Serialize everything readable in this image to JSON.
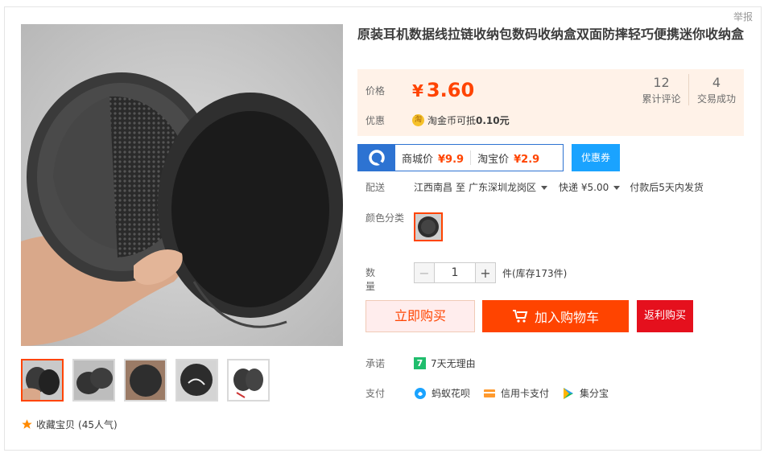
{
  "header": {
    "report_label": "举报"
  },
  "product": {
    "title": "原装耳机数据线拉链收纳包数码收纳盒双面防摔轻巧便携迷你收纳盒"
  },
  "price": {
    "label": "价格",
    "currency": "¥",
    "amount": "3.60",
    "reviews_count": "12",
    "reviews_label": "累计评论",
    "deals_count": "4",
    "deals_label": "交易成功"
  },
  "promo": {
    "label": "优惠",
    "icon_text": "淘",
    "text_prefix": "淘金币可抵",
    "text_amount": "0.10元"
  },
  "coupon": {
    "mall_label": "商城价",
    "mall_price": "¥9.9",
    "taobao_label": "淘宝价",
    "taobao_price": "¥2.9",
    "button_label": "优惠券"
  },
  "shipping": {
    "label": "配送",
    "from": "江西南昌",
    "to_word": "至",
    "destination": "广东深圳龙岗区",
    "express": "快递",
    "fee": "¥5.00",
    "dispatch": "付款后5天内发货"
  },
  "color": {
    "label": "颜色分类"
  },
  "quantity": {
    "label": "数量",
    "value": "1",
    "minus": "−",
    "plus": "+",
    "stock_text": "件(库存173件)"
  },
  "actions": {
    "buy_now": "立即购买",
    "add_cart": "加入购物车",
    "rebate": "返利购买"
  },
  "promise": {
    "label": "承诺",
    "badge": "7",
    "text": "7天无理由"
  },
  "payment": {
    "label": "支付",
    "methods": [
      "蚂蚁花呗",
      "信用卡支付",
      "集分宝"
    ]
  },
  "favorite": {
    "label": "收藏宝贝",
    "popularity": "(45人气)"
  },
  "icons": {
    "star": "star-icon",
    "zoom": "zoom-icon",
    "cart": "cart-icon",
    "huabei": "huabei-icon",
    "card": "credit-card-icon",
    "jifenbao": "jifenbao-icon"
  },
  "colors": {
    "accent": "#ff4400",
    "price_bg": "#fff2e8",
    "coupon_blue": "#2d73d2",
    "rebate_red": "#e5101d"
  }
}
